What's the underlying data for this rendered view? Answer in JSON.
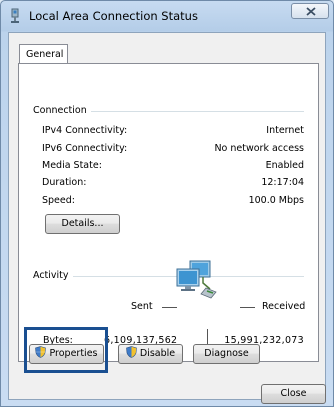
{
  "window": {
    "title": "Local Area Connection Status",
    "close_icon": "close-x-icon"
  },
  "tabs": [
    {
      "label": "General",
      "selected": true
    }
  ],
  "connection": {
    "group_label": "Connection",
    "rows": [
      {
        "label": "IPv4 Connectivity:",
        "value": "Internet"
      },
      {
        "label": "IPv6 Connectivity:",
        "value": "No network access"
      },
      {
        "label": "Media State:",
        "value": "Enabled"
      },
      {
        "label": "Duration:",
        "value": "12:17:04"
      },
      {
        "label": "Speed:",
        "value": "100.0 Mbps"
      }
    ],
    "details_button": "Details..."
  },
  "activity": {
    "group_label": "Activity",
    "sent_label": "Sent",
    "received_label": "Received",
    "bytes_label": "Bytes:",
    "bytes_sent": "6,109,137,562",
    "bytes_received": "15,991,232,073",
    "icon": "network-computers-icon"
  },
  "buttons": {
    "properties": "Properties",
    "disable": "Disable",
    "diagnose": "Diagnose",
    "close": "Close"
  },
  "colors": {
    "highlight_border": "#1a4f91",
    "titlebar": "#c7dbf1"
  }
}
